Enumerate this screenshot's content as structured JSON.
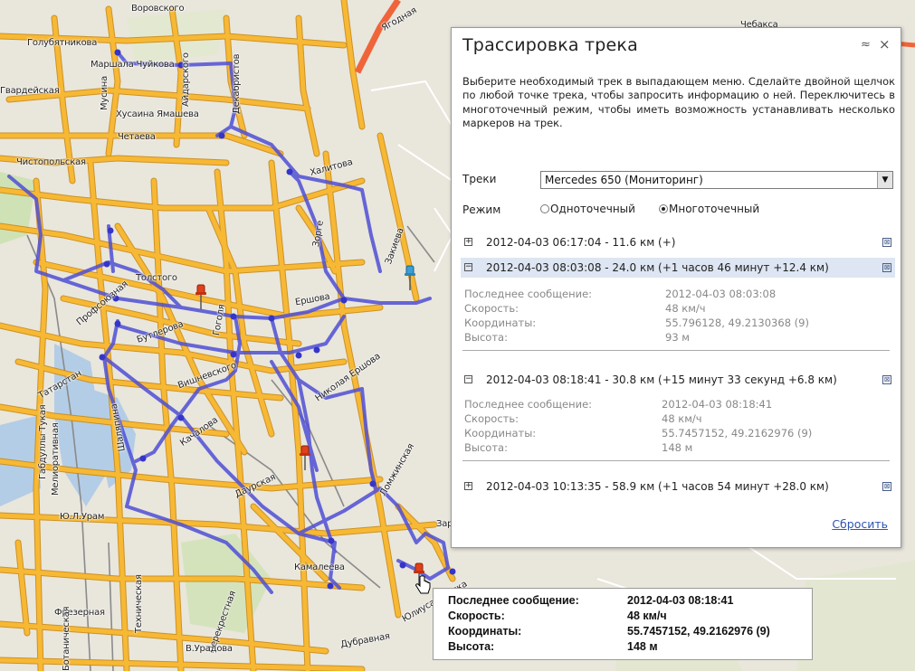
{
  "map": {
    "street_labels": [
      "Воровского",
      "Голубятникова",
      "Маршала Чуйкова",
      "Айдарского",
      "Декабристов",
      "Гвардейская",
      "Мусина",
      "Хусаина Ямашева",
      "Чистопольская",
      "Четаева",
      "Халитова",
      "Ягодная",
      "Чебакса",
      "Профсоюзная",
      "Бутлерова",
      "Толстого",
      "Ершова",
      "Гоголя",
      "Вишневского",
      "Зорге",
      "Татарстан",
      "Габдуллы Тукая",
      "Мелиоративная",
      "Качалова",
      "Шаляпина",
      "Даурская",
      "Ломжинская",
      "Ю.Л.Урам",
      "Фрезерная",
      "Техническая",
      "Дубравная",
      "Заречная",
      "Камалеева",
      "Юлиуса Фучика",
      "Перекрестная",
      "В.Урадова",
      "Ботаническая",
      "Николая Ершова",
      "Закиева"
    ]
  },
  "panel": {
    "title": "Трассировка трека",
    "collapse_glyph": "≈",
    "close_glyph": "×",
    "description": "Выберите необходимый трек в выпадающем меню. Сделайте двойной щелчок по любой точке трека, чтобы запросить информацию о ней. Переключитесь в многоточечный режим, чтобы иметь возможность устанавливать несколько маркеров на трек.",
    "tracks_label": "Треки",
    "tracks_selected": "Mercedes 650 (Мониторинг)",
    "mode_label": "Режим",
    "mode_single": "Одноточечный",
    "mode_multi": "Многоточечный",
    "mode_selected": "multi",
    "segments": [
      {
        "text": "2012-04-03 06:17:04 - 11.6 км (+)",
        "expander": "+",
        "delete_glyph": "⊠"
      },
      {
        "text": "2012-04-03 08:03:08 - 24.0 км (+1 часов 46 минут +12.4 км)",
        "expander": "−",
        "delete_glyph": "⊠",
        "details": {
          "last_message_label": "Последнее сообщение:",
          "last_message": "2012-04-03 08:03:08",
          "speed_label": "Скорость:",
          "speed": "48 км/ч",
          "coords_label": "Координаты:",
          "coords": "55.796128, 49.2130368 (9)",
          "altitude_label": "Высота:",
          "altitude": "93 м"
        }
      },
      {
        "text": "2012-04-03 08:18:41 - 30.8 км (+15 минут 33 секунд +6.8 км)",
        "expander": "−",
        "delete_glyph": "⊠",
        "details": {
          "last_message_label": "Последнее сообщение:",
          "last_message": "2012-04-03 08:18:41",
          "speed_label": "Скорость:",
          "speed": "48 км/ч",
          "coords_label": "Координаты:",
          "coords": "55.7457152, 49.2162976 (9)",
          "altitude_label": "Высота:",
          "altitude": "148 м"
        }
      },
      {
        "text": "2012-04-03 10:13:35 - 58.9 км (+1 часов 54 минут +28.0 км)",
        "expander": "+",
        "delete_glyph": "⊠"
      }
    ],
    "reset_label": "Сбросить"
  },
  "tooltip": {
    "last_message_label": "Последнее сообщение:",
    "last_message": "2012-04-03 08:18:41",
    "speed_label": "Скорость:",
    "speed": "48 км/ч",
    "coords_label": "Координаты:",
    "coords": "55.7457152, 49.2162976 (9)",
    "altitude_label": "Высота:",
    "altitude": "148 м"
  },
  "colors": {
    "road": "#f7b834",
    "road_edge": "#c98a14",
    "track": "#4f4fd6",
    "water": "#b3cde6",
    "green": "#cfe2b5",
    "pin_red": "#e0401b",
    "pin_blue": "#3a9fd6"
  }
}
